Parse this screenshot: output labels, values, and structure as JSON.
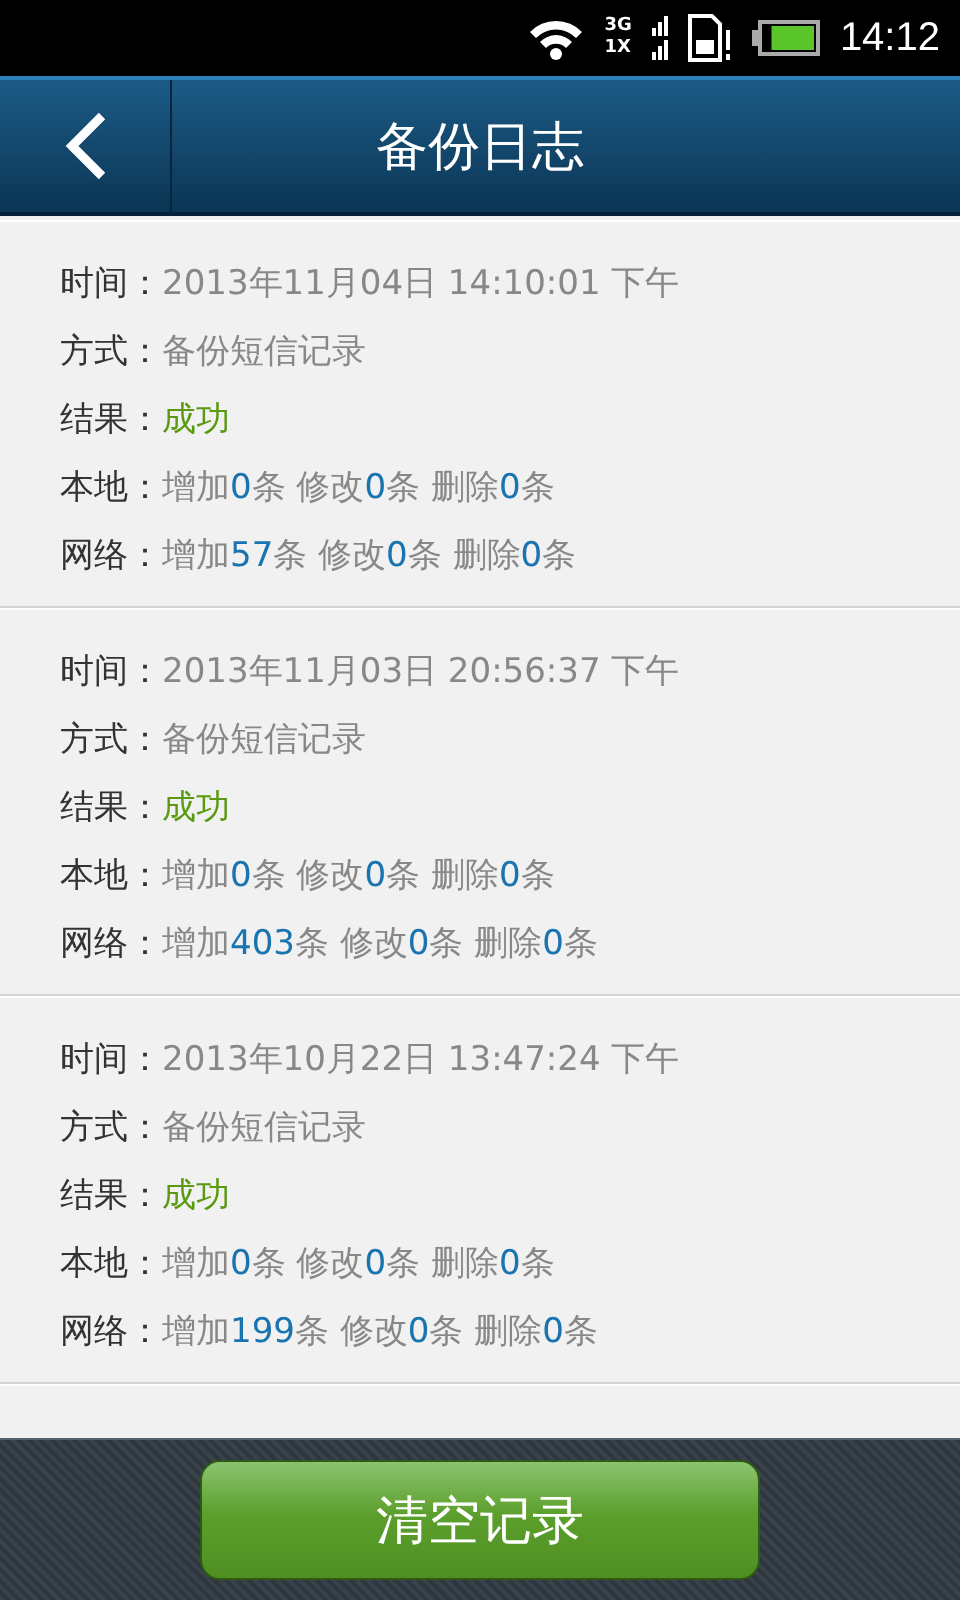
{
  "status_bar": {
    "network_top": "3G",
    "network_bottom": "1X",
    "time": "14:12"
  },
  "header": {
    "title": "备份日志"
  },
  "entries": [
    {
      "lines": [
        {
          "label": "时间：",
          "segments": [
            {
              "text": "2013年11月04日 14:10:01 下午",
              "kind": "plain"
            }
          ]
        },
        {
          "label": "方式：",
          "segments": [
            {
              "text": "备份短信记录",
              "kind": "plain"
            }
          ]
        },
        {
          "label": "结果：",
          "segments": [
            {
              "text": "成功",
              "kind": "success"
            }
          ]
        },
        {
          "label": "本地：",
          "segments": [
            {
              "text": "增加",
              "kind": "plain"
            },
            {
              "text": "0",
              "kind": "count"
            },
            {
              "text": "条 修改",
              "kind": "plain"
            },
            {
              "text": "0",
              "kind": "count"
            },
            {
              "text": "条 删除",
              "kind": "plain"
            },
            {
              "text": "0",
              "kind": "count"
            },
            {
              "text": "条",
              "kind": "plain"
            }
          ]
        },
        {
          "label": "网络：",
          "segments": [
            {
              "text": "增加",
              "kind": "plain"
            },
            {
              "text": "57",
              "kind": "count"
            },
            {
              "text": "条 修改",
              "kind": "plain"
            },
            {
              "text": "0",
              "kind": "count"
            },
            {
              "text": "条 删除",
              "kind": "plain"
            },
            {
              "text": "0",
              "kind": "count"
            },
            {
              "text": "条",
              "kind": "plain"
            }
          ]
        }
      ]
    },
    {
      "lines": [
        {
          "label": "时间：",
          "segments": [
            {
              "text": "2013年11月03日 20:56:37 下午",
              "kind": "plain"
            }
          ]
        },
        {
          "label": "方式：",
          "segments": [
            {
              "text": "备份短信记录",
              "kind": "plain"
            }
          ]
        },
        {
          "label": "结果：",
          "segments": [
            {
              "text": "成功",
              "kind": "success"
            }
          ]
        },
        {
          "label": "本地：",
          "segments": [
            {
              "text": "增加",
              "kind": "plain"
            },
            {
              "text": "0",
              "kind": "count"
            },
            {
              "text": "条 修改",
              "kind": "plain"
            },
            {
              "text": "0",
              "kind": "count"
            },
            {
              "text": "条 删除",
              "kind": "plain"
            },
            {
              "text": "0",
              "kind": "count"
            },
            {
              "text": "条",
              "kind": "plain"
            }
          ]
        },
        {
          "label": "网络：",
          "segments": [
            {
              "text": "增加",
              "kind": "plain"
            },
            {
              "text": "403",
              "kind": "count"
            },
            {
              "text": "条 修改",
              "kind": "plain"
            },
            {
              "text": "0",
              "kind": "count"
            },
            {
              "text": "条 删除",
              "kind": "plain"
            },
            {
              "text": "0",
              "kind": "count"
            },
            {
              "text": "条",
              "kind": "plain"
            }
          ]
        }
      ]
    },
    {
      "lines": [
        {
          "label": "时间：",
          "segments": [
            {
              "text": "2013年10月22日 13:47:24 下午",
              "kind": "plain"
            }
          ]
        },
        {
          "label": "方式：",
          "segments": [
            {
              "text": "备份短信记录",
              "kind": "plain"
            }
          ]
        },
        {
          "label": "结果：",
          "segments": [
            {
              "text": "成功",
              "kind": "success"
            }
          ]
        },
        {
          "label": "本地：",
          "segments": [
            {
              "text": "增加",
              "kind": "plain"
            },
            {
              "text": "0",
              "kind": "count"
            },
            {
              "text": "条 修改",
              "kind": "plain"
            },
            {
              "text": "0",
              "kind": "count"
            },
            {
              "text": "条 删除",
              "kind": "plain"
            },
            {
              "text": "0",
              "kind": "count"
            },
            {
              "text": "条",
              "kind": "plain"
            }
          ]
        },
        {
          "label": "网络：",
          "segments": [
            {
              "text": "增加",
              "kind": "plain"
            },
            {
              "text": "199",
              "kind": "count"
            },
            {
              "text": "条 修改",
              "kind": "plain"
            },
            {
              "text": "0",
              "kind": "count"
            },
            {
              "text": "条 删除",
              "kind": "plain"
            },
            {
              "text": "0",
              "kind": "count"
            },
            {
              "text": "条",
              "kind": "plain"
            }
          ]
        }
      ]
    }
  ],
  "footer": {
    "button": "清空记录"
  }
}
